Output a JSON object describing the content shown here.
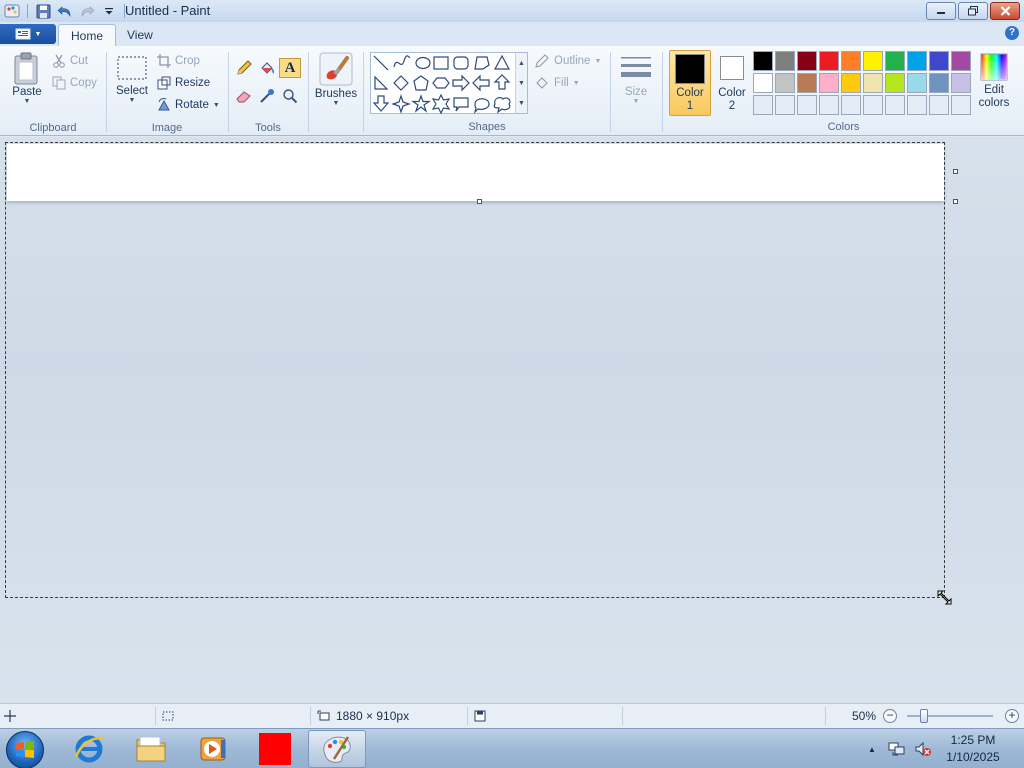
{
  "window": {
    "title": "Untitled - Paint"
  },
  "tabs": [
    {
      "label": "Home",
      "active": true
    },
    {
      "label": "View",
      "active": false
    }
  ],
  "ribbon": {
    "clipboard": {
      "label": "Clipboard",
      "paste": "Paste",
      "cut": "Cut",
      "copy": "Copy"
    },
    "image": {
      "label": "Image",
      "select": "Select",
      "crop": "Crop",
      "resize": "Resize",
      "rotate": "Rotate"
    },
    "tools": {
      "label": "Tools",
      "selected_tool": "text-icon"
    },
    "brushes": {
      "label": "Brushes"
    },
    "shapes": {
      "label": "Shapes",
      "outline": "Outline",
      "fill": "Fill"
    },
    "size": {
      "label": "Size"
    },
    "colors": {
      "label": "Colors",
      "color1_line1": "Color",
      "color1_line2": "1",
      "color2_line1": "Color",
      "color2_line2": "2",
      "edit_line1": "Edit",
      "edit_line2": "colors",
      "color1_value": "#000000",
      "color2_value": "#ffffff",
      "palette": [
        "#000000",
        "#7f7f7f",
        "#880015",
        "#ed1c24",
        "#ff7f27",
        "#fff200",
        "#22b14c",
        "#00a2e8",
        "#3f48cc",
        "#a349a4",
        "#ffffff",
        "#c3c3c3",
        "#b97a57",
        "#ffaec9",
        "#ffc90e",
        "#efe4b0",
        "#b5e61d",
        "#99d9ea",
        "#7092be",
        "#c8bfe7",
        "#e4ecf5",
        "#e4ecf5",
        "#e4ecf5",
        "#e4ecf5",
        "#e4ecf5",
        "#e4ecf5",
        "#e4ecf5",
        "#e4ecf5",
        "#e4ecf5",
        "#e4ecf5"
      ]
    }
  },
  "status": {
    "canvas_size": "1880 × 910px",
    "zoom": "50%",
    "zoom_fraction": 0.2
  },
  "taskbar": {
    "time": "1:25 PM",
    "date": "1/10/2025"
  }
}
